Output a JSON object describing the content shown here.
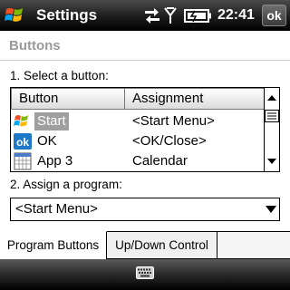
{
  "titlebar": {
    "title": "Settings",
    "time": "22:41",
    "ok_label": "ok",
    "icons": [
      "windows-start-flag",
      "sync-arrows",
      "signal-antenna",
      "battery-charging"
    ]
  },
  "header": {
    "title": "Buttons"
  },
  "step1_label": "1. Select a button:",
  "list": {
    "columns": [
      "Button",
      "Assignment"
    ],
    "rows": [
      {
        "icon": "windows-start-flag",
        "name": "Start",
        "assignment": "<Start Menu>",
        "selected": true
      },
      {
        "icon": "ok-icon",
        "name": "OK",
        "assignment": "<OK/Close>",
        "selected": false
      },
      {
        "icon": "calendar-icon",
        "name": "App 3",
        "assignment": "Calendar",
        "selected": false
      }
    ]
  },
  "step2_label": "2. Assign a program:",
  "program_select": {
    "value": "<Start Menu>"
  },
  "tabs": [
    {
      "label": "Program Buttons",
      "active": true
    },
    {
      "label": "Up/Down Control",
      "active": false
    }
  ],
  "softbar": {
    "icon": "keyboard-icon"
  },
  "colors": {
    "title_bar": "#000000",
    "selection": "#9f9f9f",
    "header_text": "#9a9a9a"
  }
}
